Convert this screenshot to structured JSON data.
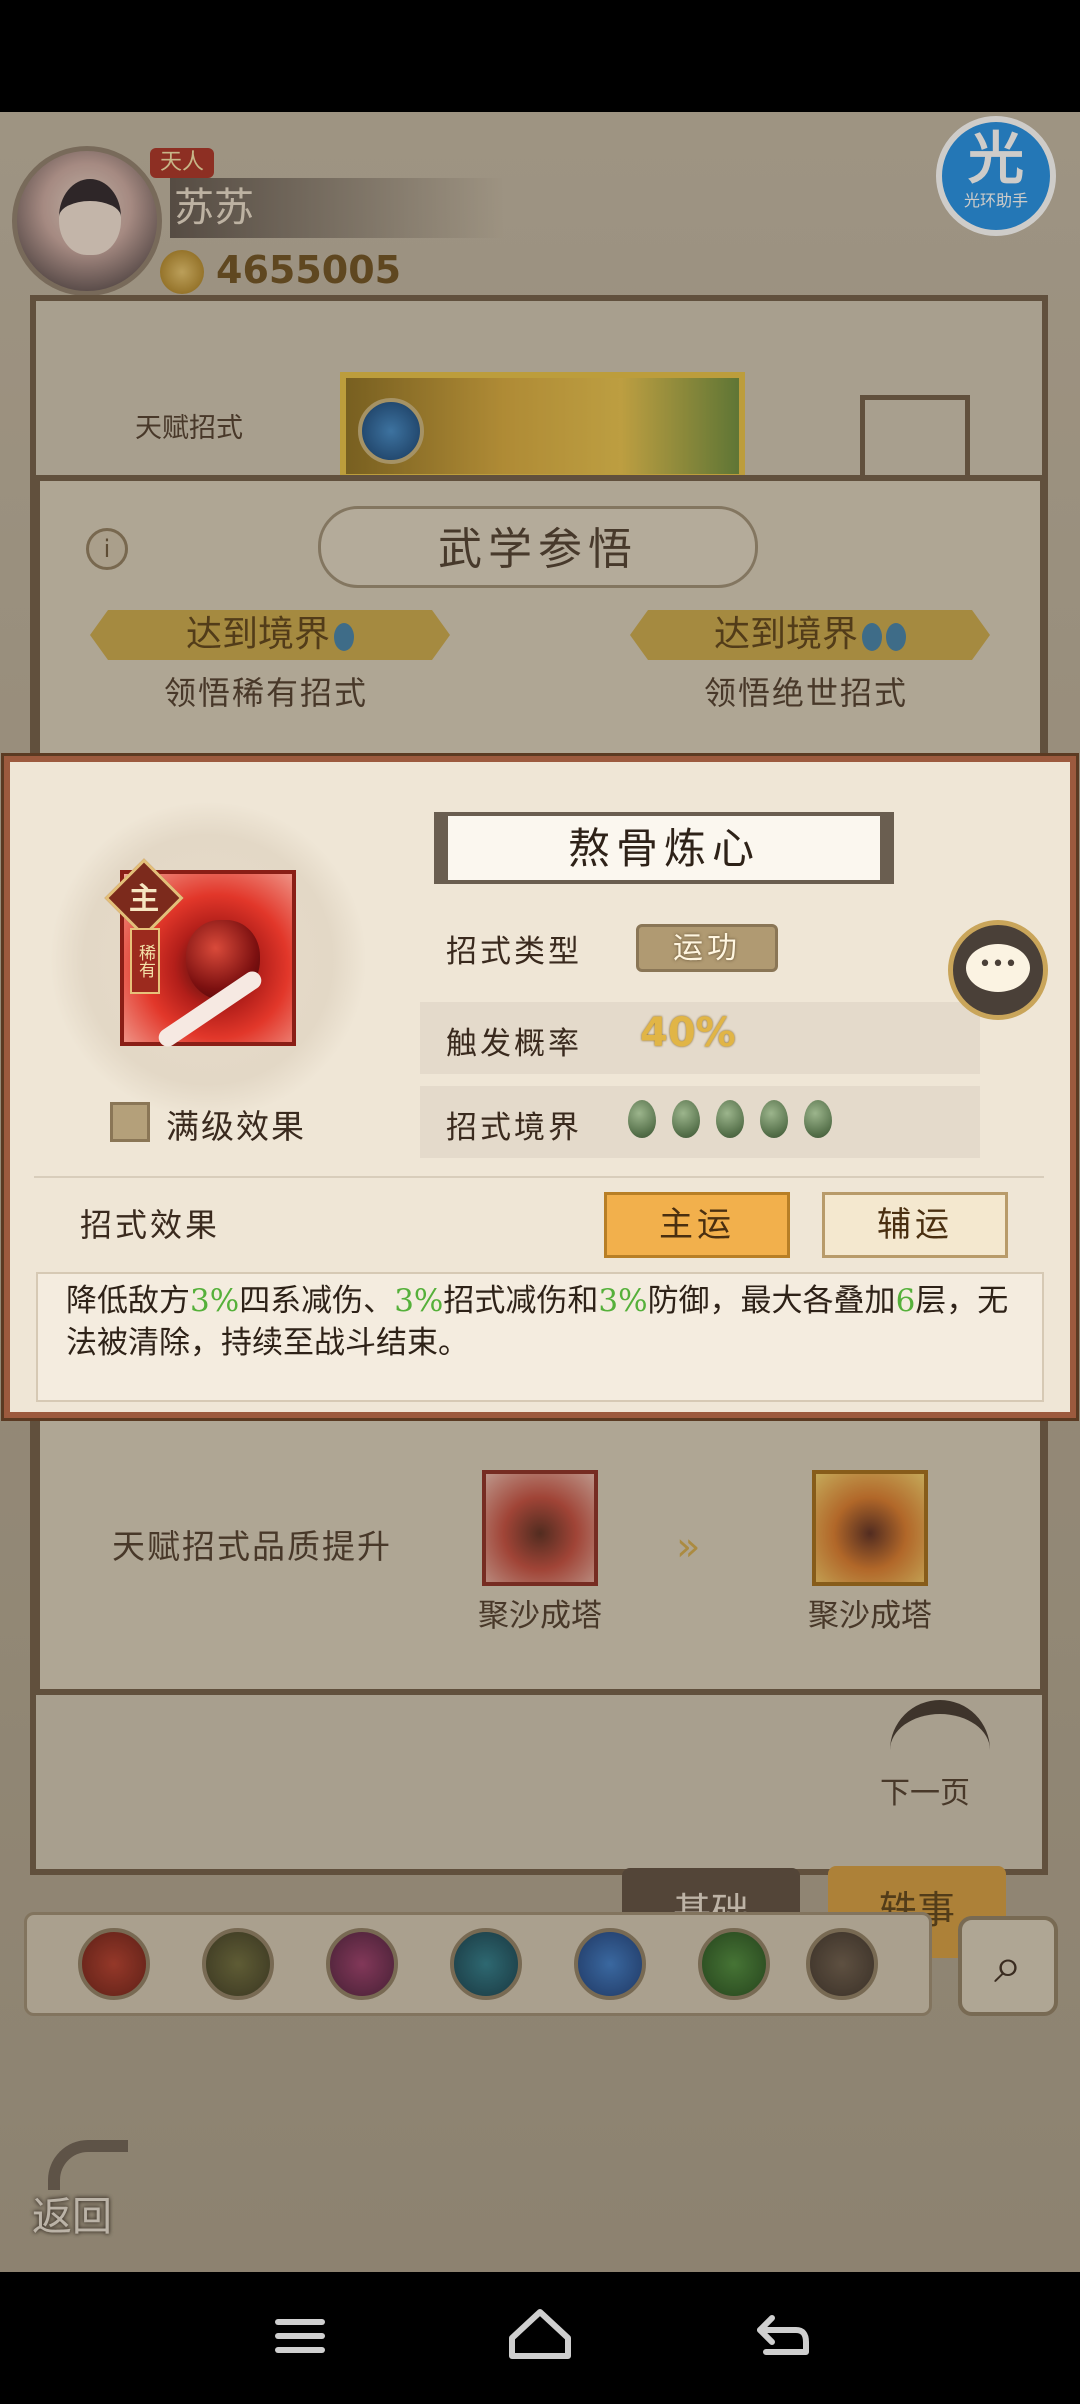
{
  "header": {
    "rank_badge": "天人",
    "player_name": "苏苏",
    "coins": "4655005",
    "assist_glyph": "光",
    "assist_label": "光环助手"
  },
  "background": {
    "talent_skill_label": "天赋招式",
    "panel_title": "武学参悟",
    "info_glyph": "i",
    "realm_banner_left": "达到境界",
    "realm_banner_right": "达到境界",
    "realm_sub_left": "领悟稀有招式",
    "realm_sub_right": "领悟绝世招式",
    "upgrade_label": "天赋招式品质提升",
    "skill_from_name": "聚沙成塔",
    "skill_to_name": "聚沙成塔",
    "arrow_glyph": "»",
    "next_page": "下一页",
    "tab_base": "基础",
    "tab_anecdote": "轶事",
    "back_label": "返回",
    "search_glyph": "⌕"
  },
  "popup": {
    "skill_name": "熬骨炼心",
    "main_tag": "主",
    "rare_tag": "稀有",
    "type_label": "招式类型",
    "type_value": "运功",
    "rate_label": "触发概率",
    "rate_value": "40%",
    "realm_label": "招式境界",
    "realm_level": 5,
    "max_level_label": "满级效果",
    "max_level_checked": false,
    "effect_label": "招式效果",
    "btn_main": "主运",
    "btn_sub": "辅运",
    "chat_glyph": "•••",
    "description": {
      "p1": "降低敌方",
      "v1": "3%",
      "p2": "四系减伤、",
      "v2": "3%",
      "p3": "招式减伤和",
      "v3": "3%",
      "p4": "防御，最大各叠加",
      "v4": "6",
      "p5": "层，无法被清除，持续至战斗结束。"
    }
  },
  "colors": {
    "highlight_green": "#55b03a",
    "rate_gold": "#e1b546",
    "main_button": "#f2b04c",
    "popup_border": "#9c5a3e"
  }
}
